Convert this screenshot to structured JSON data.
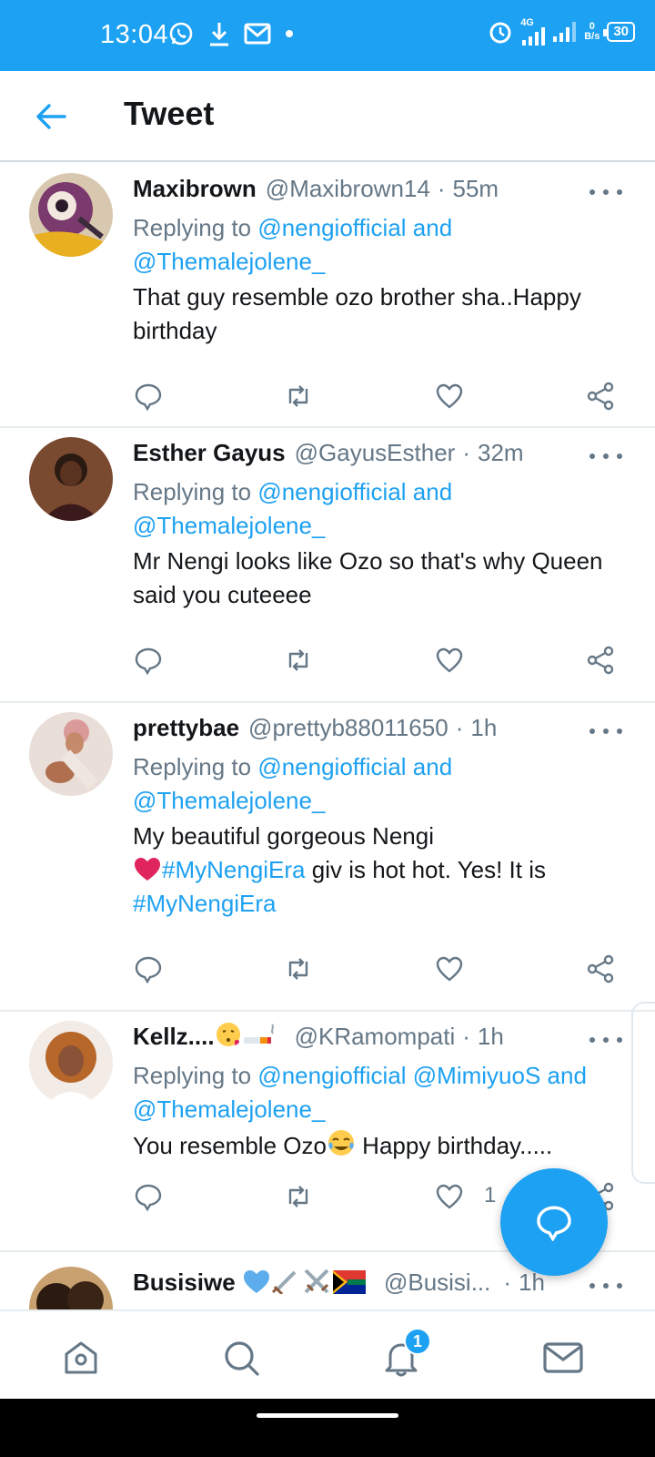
{
  "status_bar": {
    "time": "13:04",
    "network": "4G",
    "speed_value": "0",
    "speed_unit": "B/s",
    "battery": "30"
  },
  "header": {
    "title": "Tweet"
  },
  "tweets": [
    {
      "name": "Maxibrown",
      "handle": "@Maxibrown14",
      "time": "55m",
      "reply_prefix": "Replying to",
      "reply_line1": "@nengiofficial and",
      "reply_line2": "@Themalejolene_",
      "text": "That guy resemble ozo brother sha..Happy birthday"
    },
    {
      "name": "Esther Gayus",
      "handle": "@GayusEsther",
      "time": "32m",
      "reply_prefix": "Replying to",
      "reply_line1": "@nengiofficial and",
      "reply_line2": "@Themalejolene_",
      "text": "Mr Nengi looks like Ozo so that's why Queen said you cuteeee"
    },
    {
      "name": "prettybae",
      "handle": "@prettyb88011650",
      "time": "1h",
      "reply_prefix": "Replying to",
      "reply_line1": "@nengiofficial and",
      "reply_line2": "@Themalejolene_",
      "text_line1": "My beautiful gorgeous Nengi",
      "hashtag1": "#MyNengiEra",
      "text_mid": " giv is hot hot. Yes! It is",
      "hashtag2": "#MyNengiEra"
    },
    {
      "name": "Kellz....",
      "handle": "@KRamompati",
      "time": "1h",
      "reply_prefix": "Replying to",
      "reply_line1": "@nengiofficial @MimiyuoS and",
      "reply_line2": "@Themalejolene_",
      "text_a": "You resemble Ozo",
      "text_b": " Happy birthday.....",
      "like_count": "1"
    },
    {
      "name": "Busisiwe",
      "handle": "@Busisi...",
      "time": "1h"
    }
  ],
  "nav": {
    "notification_count": "1"
  },
  "icons": {
    "back": "arrow-left-icon",
    "more": "more-horizontal-icon",
    "reply": "reply-icon",
    "retweet": "retweet-icon",
    "like": "heart-icon",
    "share": "share-icon",
    "compose": "compose-reply-icon",
    "home": "home-icon",
    "search": "search-icon",
    "notifications": "bell-icon",
    "messages": "mail-icon"
  },
  "colors": {
    "accent": "#1da1f2",
    "text": "#14171a",
    "secondary": "#657786",
    "heart_emoji": "#e0245e"
  }
}
